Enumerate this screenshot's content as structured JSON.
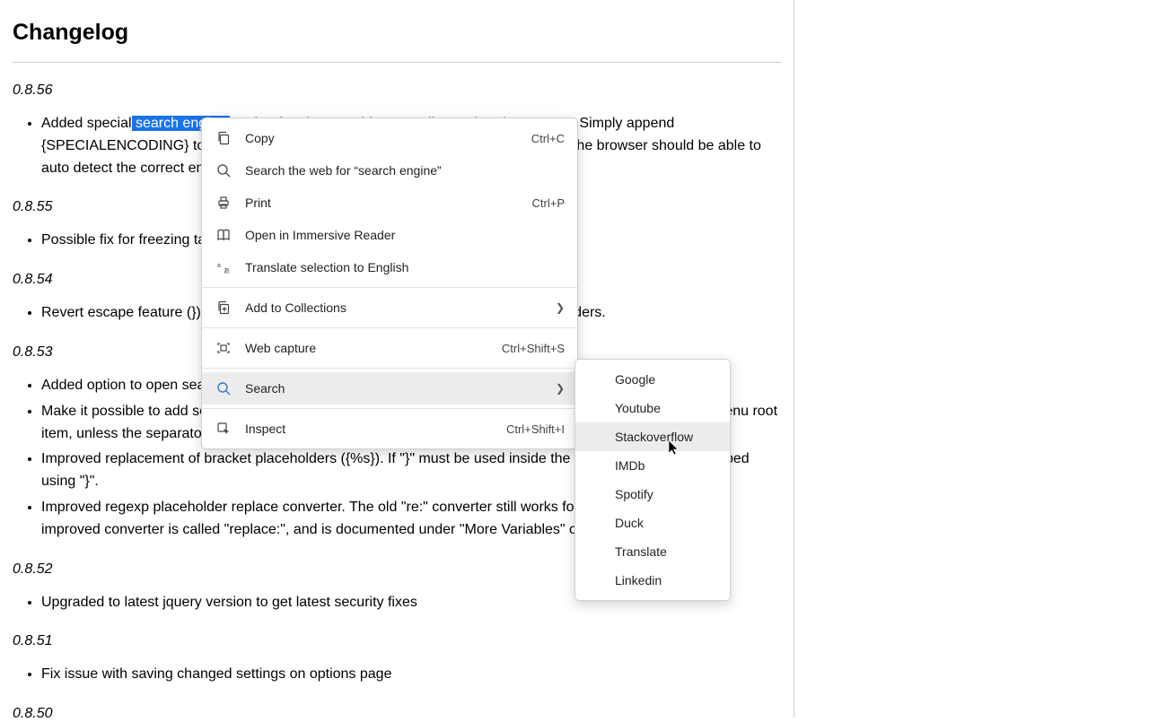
{
  "page": {
    "title": "Changelog",
    "highlight_pre": "Added special",
    "highlight_text": " search engine ",
    "sections": [
      {
        "version": "0.8.56",
        "items": [
          "marker for sites requiring encodings other than UTF-8. Simply append {SPECIALENCODING} to the search URL. The search phrase will be left as is, and the browser should be able to auto detect the correct encoding to use for the search engine."
        ]
      },
      {
        "version": "0.8.55",
        "items": [
          "Possible fix for freezing tab issue from last release."
        ]
      },
      {
        "version": "0.8.54",
        "items": [
          "Revert escape feature (}) from previous release. Only special syntax inside placeholders."
        ]
      },
      {
        "version": "0.8.53",
        "items": [
          "Added option to open search in incognito mode, and added placeholder {target|incognito}.",
          "Make it possible to add separators within a submenu. Previously the separator was applied above the submenu root item, unless the separator was the first item in the submenu.",
          "Improved replacement of bracket placeholders ({%s}). If \"}\" must be used inside the brackets, it can be escaped using \"}\".",
          "Improved regexp placeholder replace converter. The old \"re:\" converter still works for compatibility. The new improved converter is called \"replace:\", and is documented under \"More Variables\" on the options page."
        ]
      },
      {
        "version": "0.8.52",
        "items": [
          "Upgraded to latest jquery version to get latest security fixes"
        ]
      },
      {
        "version": "0.8.51",
        "items": [
          "Fix issue with saving changed settings on options page"
        ]
      },
      {
        "version": "0.8.50",
        "items": []
      }
    ]
  },
  "menu": {
    "copy": "Copy",
    "copy_sc": "Ctrl+C",
    "searchweb": "Search the web for “search engine”",
    "print": "Print",
    "print_sc": "Ctrl+P",
    "immersive": "Open in Immersive Reader",
    "translate": "Translate selection to English",
    "collections": "Add to Collections",
    "webcapture": "Web capture",
    "webcapture_sc": "Ctrl+Shift+S",
    "search": "Search",
    "inspect": "Inspect",
    "inspect_sc": "Ctrl+Shift+I"
  },
  "submenu": {
    "items": [
      "Google",
      "Youtube",
      "Stackoverflow",
      "IMDb",
      "Spotify",
      "Duck",
      "Translate",
      "Linkedin"
    ],
    "hover_index": 2
  }
}
